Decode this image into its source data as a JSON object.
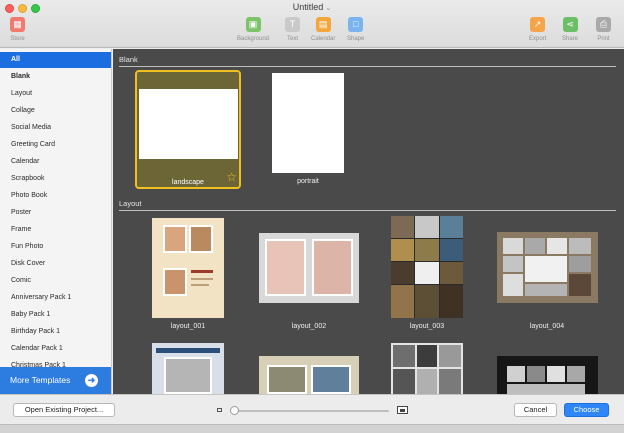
{
  "window": {
    "title": "Untitled"
  },
  "toolbar": {
    "store": "Store",
    "background": "Background",
    "text": "Text",
    "calendar": "Calendar",
    "shape": "Shape",
    "export": "Export",
    "share": "Share",
    "print": "Print"
  },
  "sidebar": {
    "items": [
      {
        "label": "All"
      },
      {
        "label": "Blank"
      },
      {
        "label": "Layout"
      },
      {
        "label": "Collage"
      },
      {
        "label": "Social Media"
      },
      {
        "label": "Greeting Card"
      },
      {
        "label": "Calendar"
      },
      {
        "label": "Scrapbook"
      },
      {
        "label": "Photo Book"
      },
      {
        "label": "Poster"
      },
      {
        "label": "Frame"
      },
      {
        "label": "Fun Photo"
      },
      {
        "label": "Disk Cover"
      },
      {
        "label": "Comic"
      },
      {
        "label": "Anniversary Pack 1"
      },
      {
        "label": "Baby Pack 1"
      },
      {
        "label": "Birthday Pack 1"
      },
      {
        "label": "Calendar Pack 1"
      },
      {
        "label": "Christmas Pack 1"
      }
    ],
    "more_templates": "More Templates"
  },
  "gallery": {
    "blank_section": "Blank",
    "layout_section": "Layout",
    "blank_items": [
      {
        "label": "landscape"
      },
      {
        "label": "portrait"
      }
    ],
    "layout_items": [
      {
        "label": "layout_001"
      },
      {
        "label": "layout_002"
      },
      {
        "label": "layout_003"
      },
      {
        "label": "layout_004"
      }
    ]
  },
  "bottom": {
    "open_existing": "Open Existing Project...",
    "cancel": "Cancel",
    "choose": "Choose",
    "zoom_level": 0
  },
  "colors": {
    "accent": "#1c6ee0",
    "selection_border": "#f0c020",
    "gallery_bg": "#4a4a4a"
  }
}
